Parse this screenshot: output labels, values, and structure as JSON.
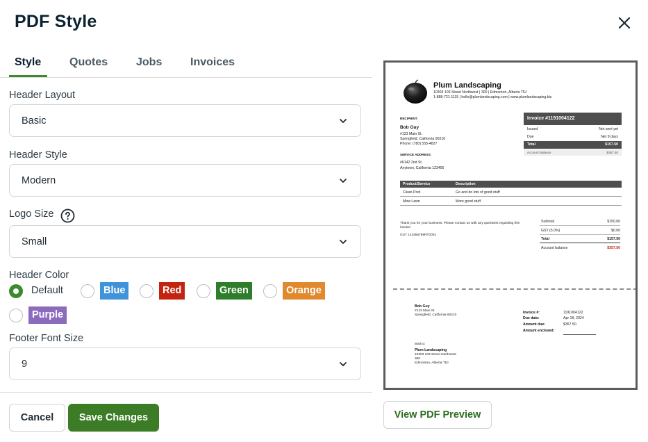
{
  "dialog": {
    "title": "PDF Style"
  },
  "tabs": [
    {
      "label": "Style"
    },
    {
      "label": "Quotes"
    },
    {
      "label": "Jobs"
    },
    {
      "label": "Invoices"
    }
  ],
  "form": {
    "header_layout": {
      "label": "Header Layout",
      "value": "Basic"
    },
    "header_style": {
      "label": "Header Style",
      "value": "Modern"
    },
    "logo_size": {
      "label": "Logo Size",
      "value": "Small"
    },
    "header_color": {
      "label": "Header Color",
      "selected": "Default",
      "options": [
        {
          "label": "Default",
          "color": ""
        },
        {
          "label": "Blue",
          "color": "#3f93d8"
        },
        {
          "label": "Red",
          "color": "#c4240f"
        },
        {
          "label": "Green",
          "color": "#2e7d2a"
        },
        {
          "label": "Orange",
          "color": "#e0892e"
        },
        {
          "label": "Purple",
          "color": "#8c6bbf"
        }
      ]
    },
    "footer_font_size": {
      "label": "Footer Font Size",
      "value": "9"
    }
  },
  "buttons": {
    "cancel": "Cancel",
    "save": "Save Changes",
    "view_preview": "View PDF Preview"
  },
  "pdf": {
    "company": {
      "name": "Plum Landscaping",
      "address": "10303 103 Street Northwest  |  300  |  Edmonton, Alberta T5J",
      "contact": "1-888-721-1115  |  hello@plumlandscaping.com  |  www.plumlandscaping.biz"
    },
    "recipient_label": "RECIPIENT:",
    "recipient": {
      "name": "Bob Guy",
      "line1": "#123 Main St.",
      "line2": "Springfield, California 90210",
      "phone": "Phone: (780) 555-4827"
    },
    "service_label": "SERVICE ADDRESS:",
    "service": {
      "line1": "#6142 2nd St.",
      "line2": "Anytown, California 123456"
    },
    "invoice_title": "Invoice #1191004122",
    "invoice_rows": [
      {
        "label": "Issued",
        "value": "Not sent yet"
      },
      {
        "label": "Due",
        "value": "Net 9 days"
      },
      {
        "label": "Total",
        "value": "$157.50"
      },
      {
        "label": "Account Balance",
        "value": "$357.50"
      }
    ],
    "table_headers": [
      "Product/Service",
      "Description"
    ],
    "line_items": [
      {
        "product": "Clean Pool",
        "description": "Go and do lots of good stuff"
      },
      {
        "product": "Mow Lawn",
        "description": "More good stuff"
      }
    ],
    "thanks_line1": "Thank you for your business. Please contact us with any questions regarding this",
    "thanks_line2": "invoice.",
    "gst_number": "GST 123456789RT0001",
    "summary": [
      {
        "label": "Subtotal",
        "value": "$150.00"
      },
      {
        "label": "GST (5.0%)",
        "value": "$0.00"
      },
      {
        "label": "Total",
        "value": "$157.50"
      },
      {
        "label": "Account balance",
        "value": "$357.50"
      }
    ],
    "stub": {
      "name": "Bob Guy",
      "line1": "#123 Main St.",
      "line2": "Springfield, California 90210",
      "fields": [
        {
          "label": "Invoice #:",
          "value": "1191004122"
        },
        {
          "label": "Due date:",
          "value": "Apr 18, 2024"
        },
        {
          "label": "Amount due:",
          "value": "$357.50"
        },
        {
          "label": "Amount enclosed:",
          "value": ""
        }
      ],
      "mail_to_label": "Mail to:",
      "mail_to_name": "Plum Landscaping",
      "mail_line1": "10303 103 Street Northwest",
      "mail_line2": "300",
      "mail_line3": "Edmonton, Alberta T5J"
    }
  }
}
